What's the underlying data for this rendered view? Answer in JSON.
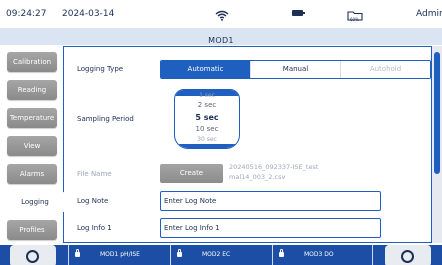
{
  "status": {
    "time": "09:24:27",
    "date": "2024-03-14",
    "icons": [
      "wifi-icon",
      "battery-icon",
      "storage-folder-icon"
    ],
    "storage_percent": "60%",
    "user": "Admin"
  },
  "title": "MOD1",
  "tabs": [
    {
      "label": "Calibration",
      "active": false
    },
    {
      "label": "Reading",
      "active": false
    },
    {
      "label": "Temperature",
      "active": false
    },
    {
      "label": "View",
      "active": false
    },
    {
      "label": "Alarms",
      "active": false
    },
    {
      "label": "Logging",
      "active": true
    },
    {
      "label": "Profiles",
      "active": false
    }
  ],
  "logging_type": {
    "label": "Logging Type",
    "options": [
      "Automatic",
      "Manual",
      "Autohold"
    ],
    "selected": "Automatic",
    "disabled": [
      "Autohold"
    ]
  },
  "sampling_period": {
    "label": "Sampling Period",
    "options_visible": [
      "1 sec",
      "2 sec",
      "5 sec",
      "10 sec",
      "30 sec"
    ],
    "selected": "5 sec"
  },
  "file_name": {
    "label": "File Name",
    "button": "Create",
    "value_line1": "20240516_092337-ISE_test",
    "value_line2": "mal14_003_2.csv"
  },
  "log_note": {
    "label": "Log Note",
    "value": "Enter Log Note"
  },
  "log_info_1": {
    "label": "Log Info 1",
    "value": "Enter Log Info 1"
  },
  "bottom": {
    "channels": [
      "MOD1 pH/ISE",
      "MOD2 EC",
      "MOD3 DO"
    ],
    "left_button_icon": "search-icon",
    "right_button_icon": "search-icon"
  },
  "colors": {
    "accent": "#1f5fc0",
    "bottom_bar": "#1b4ea4",
    "title_bar": "#dbe4f3",
    "tab_gray": "#999999"
  }
}
